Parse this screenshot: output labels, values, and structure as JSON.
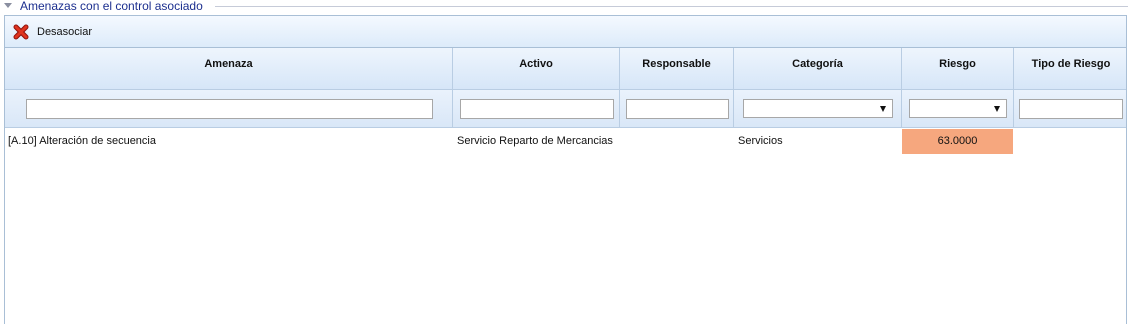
{
  "section": {
    "title": "Amenazas con el control asociado"
  },
  "toolbar": {
    "disassociate_label": "Desasociar"
  },
  "table": {
    "columns": [
      "Amenaza",
      "Activo",
      "Responsable",
      "Categoría",
      "Riesgo",
      "Tipo de Riesgo"
    ],
    "filters": {
      "amenaza": "",
      "activo": "",
      "responsable": "",
      "categoria": "",
      "riesgo": "",
      "tipo_riesgo": ""
    },
    "rows": [
      {
        "amenaza": "[A.10] Alteración de secuencia",
        "activo": "Servicio Reparto de Mercancias",
        "responsable": "",
        "categoria": "Servicios",
        "riesgo": "63.0000",
        "tipo_riesgo": ""
      }
    ]
  },
  "colors": {
    "risk_cell": "#f6a77e",
    "title_color": "#1c2f8f",
    "delete_icon": "#d8261b"
  }
}
